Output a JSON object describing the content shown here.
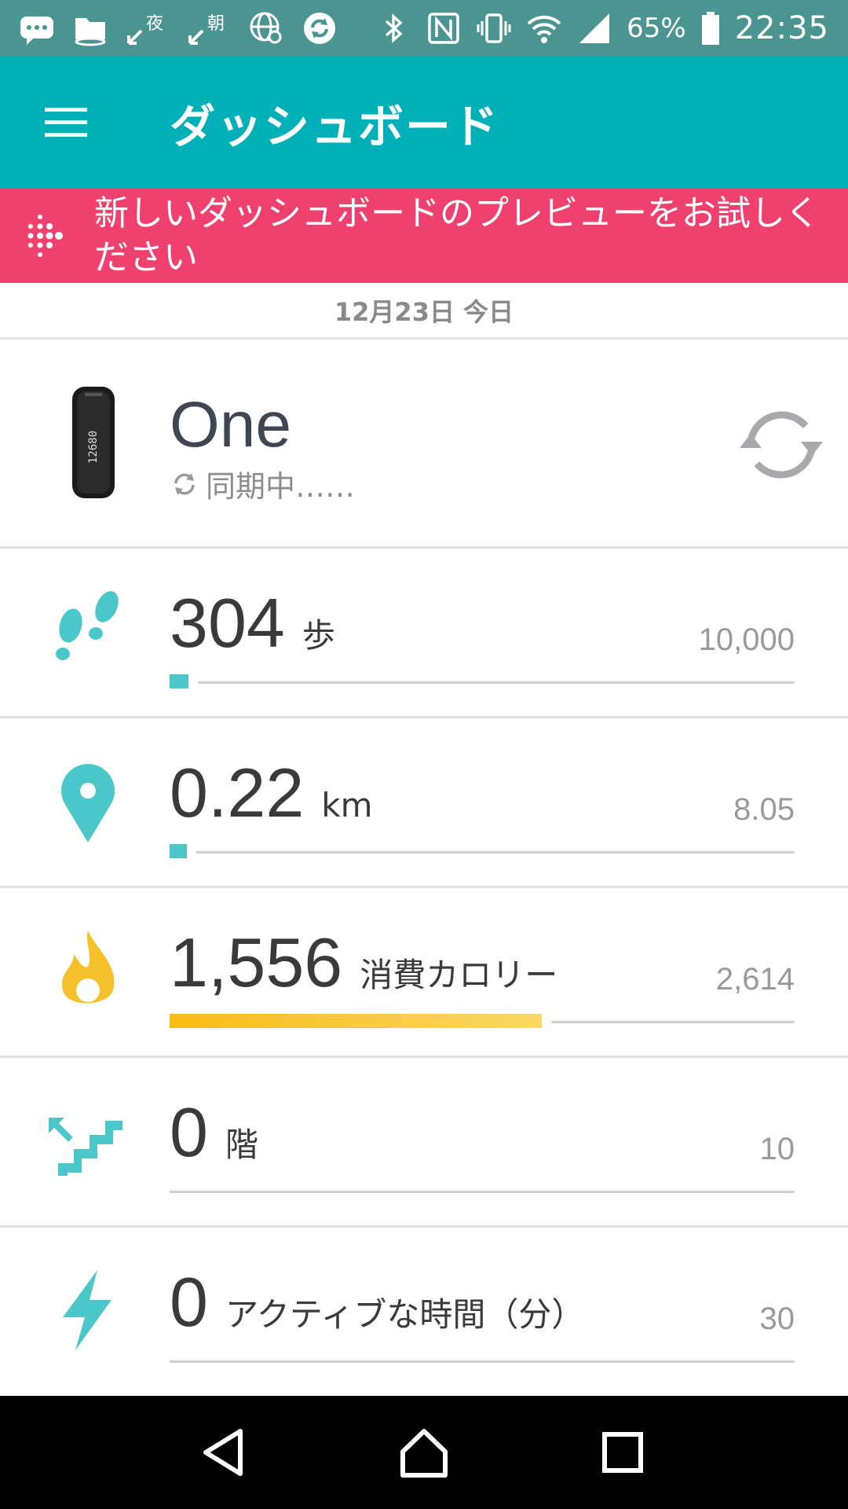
{
  "status_bar": {
    "icons_left": [
      "chat-bubble-icon",
      "folder-icon",
      "night-mode-icon",
      "morning-mode-icon",
      "globe-search-icon",
      "sync-icon"
    ],
    "night_label": "夜",
    "morning_label": "朝",
    "icons_right": [
      "bluetooth-icon",
      "nfc-icon",
      "vibrate-icon",
      "wifi-icon",
      "signal-icon",
      "battery-icon"
    ],
    "battery": "65%",
    "time": "22:35"
  },
  "app_bar": {
    "title": "ダッシュボード",
    "background": "#00b0b9"
  },
  "promo": {
    "text": "新しいダッシュボードのプレビューをお試しください",
    "background": "#f0406d"
  },
  "date_label": "12月23日 今日",
  "device": {
    "name": "One",
    "status": "同期中……",
    "tracker_display": "12680"
  },
  "stats": [
    {
      "id": "steps",
      "value": "304",
      "unit": "歩",
      "goal": "10,000",
      "progress": 0.03,
      "color": "#4cc7c9",
      "icon": "footsteps-icon"
    },
    {
      "id": "distance",
      "value": "0.22",
      "unit": "km",
      "goal": "8.05",
      "progress": 0.027,
      "color": "#4cc7c9",
      "icon": "map-pin-icon"
    },
    {
      "id": "calories",
      "value": "1,556",
      "unit": "消費カロリー",
      "goal": "2,614",
      "progress": 0.595,
      "color": "#f5c02a",
      "icon": "flame-icon"
    },
    {
      "id": "floors",
      "value": "0",
      "unit": "階",
      "goal": "10",
      "progress": 0,
      "color": "#4cc7c9",
      "icon": "stairs-icon"
    },
    {
      "id": "active",
      "value": "0",
      "unit": "アクティブな時間（分）",
      "goal": "30",
      "progress": 0,
      "color": "#4cc7c9",
      "icon": "lightning-icon"
    }
  ],
  "nav": {
    "back": "back-icon",
    "home": "home-icon",
    "recents": "recents-icon"
  }
}
